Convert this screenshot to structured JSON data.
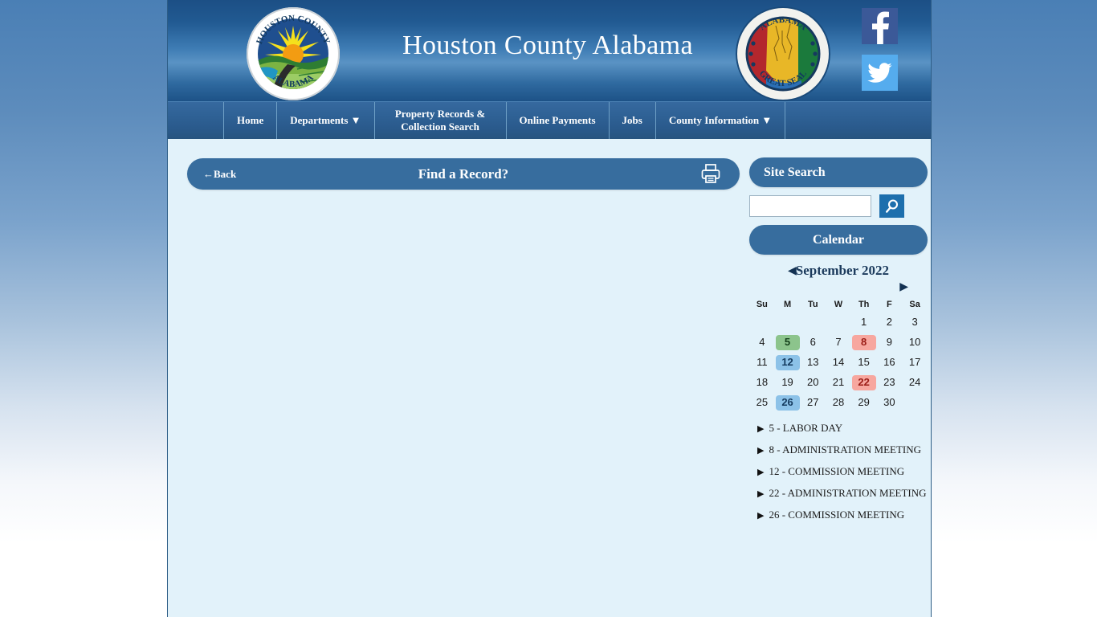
{
  "header": {
    "site_title": "Houston County Alabama",
    "county_seal_alt": "Houston County Alabama seal",
    "state_seal_alt": "Alabama Great Seal",
    "social": [
      {
        "name": "facebook",
        "glyph": "f",
        "color": "#3b5998"
      },
      {
        "name": "twitter",
        "glyph": "twitter-bird",
        "color": "#55acee"
      }
    ]
  },
  "nav": {
    "items": [
      {
        "label": "Home",
        "caret": false
      },
      {
        "label": "Departments ▼",
        "caret": true
      },
      {
        "label": "Property Records & Collection Search",
        "caret": false,
        "two_line": true
      },
      {
        "label": "Online Payments",
        "caret": false
      },
      {
        "label": "Jobs",
        "caret": false
      },
      {
        "label": "County Information ▼",
        "caret": true
      }
    ]
  },
  "record_bar": {
    "back_label": "←Back",
    "title": "Find a Record?",
    "print_icon": "printer-icon"
  },
  "sidebar": {
    "site_search_label": "Site Search",
    "search_value": "",
    "search_placeholder": "",
    "search_button_icon": "magnifier-icon",
    "calendar_label": "Calendar",
    "calendar": {
      "month_label": "September 2022",
      "prev_arrow": "◀",
      "next_arrow": "▶",
      "weekdays": [
        "Su",
        "M",
        "Tu",
        "W",
        "Th",
        "F",
        "Sa"
      ],
      "weeks": [
        [
          {
            "day": "",
            "hl": ""
          },
          {
            "day": "",
            "hl": ""
          },
          {
            "day": "",
            "hl": ""
          },
          {
            "day": "",
            "hl": ""
          },
          {
            "day": "1",
            "hl": ""
          },
          {
            "day": "2",
            "hl": ""
          },
          {
            "day": "3",
            "hl": ""
          }
        ],
        [
          {
            "day": "4",
            "hl": ""
          },
          {
            "day": "5",
            "hl": "hl-green"
          },
          {
            "day": "6",
            "hl": ""
          },
          {
            "day": "7",
            "hl": ""
          },
          {
            "day": "8",
            "hl": "hl-red"
          },
          {
            "day": "9",
            "hl": ""
          },
          {
            "day": "10",
            "hl": ""
          }
        ],
        [
          {
            "day": "11",
            "hl": ""
          },
          {
            "day": "12",
            "hl": "hl-blue"
          },
          {
            "day": "13",
            "hl": ""
          },
          {
            "day": "14",
            "hl": ""
          },
          {
            "day": "15",
            "hl": ""
          },
          {
            "day": "16",
            "hl": ""
          },
          {
            "day": "17",
            "hl": ""
          }
        ],
        [
          {
            "day": "18",
            "hl": ""
          },
          {
            "day": "19",
            "hl": ""
          },
          {
            "day": "20",
            "hl": ""
          },
          {
            "day": "21",
            "hl": ""
          },
          {
            "day": "22",
            "hl": "hl-red"
          },
          {
            "day": "23",
            "hl": ""
          },
          {
            "day": "24",
            "hl": ""
          }
        ],
        [
          {
            "day": "25",
            "hl": ""
          },
          {
            "day": "26",
            "hl": "hl-blue"
          },
          {
            "day": "27",
            "hl": ""
          },
          {
            "day": "28",
            "hl": ""
          },
          {
            "day": "29",
            "hl": ""
          },
          {
            "day": "30",
            "hl": ""
          },
          {
            "day": "",
            "hl": ""
          }
        ]
      ]
    },
    "events": [
      {
        "caret": "▶",
        "text": "5 - LABOR DAY"
      },
      {
        "caret": "▶",
        "text": "8 - ADMINISTRATION MEETING"
      },
      {
        "caret": "▶",
        "text": "12 - COMMISSION MEETING"
      },
      {
        "caret": "▶",
        "text": "22 - ADMINISTRATION MEETING"
      },
      {
        "caret": "▶",
        "text": "26 - COMMISSION MEETING"
      }
    ]
  },
  "colors": {
    "page_background": "#e2f2fa",
    "header_blue": "#215a92",
    "nav_blue": "#2f6296",
    "pill_blue": "#376d9e",
    "accent_search": "#1d6fad",
    "holiday_green": "#8cc48c",
    "meeting_red": "#f7a79f",
    "meeting_blue": "#8cc2e8"
  }
}
